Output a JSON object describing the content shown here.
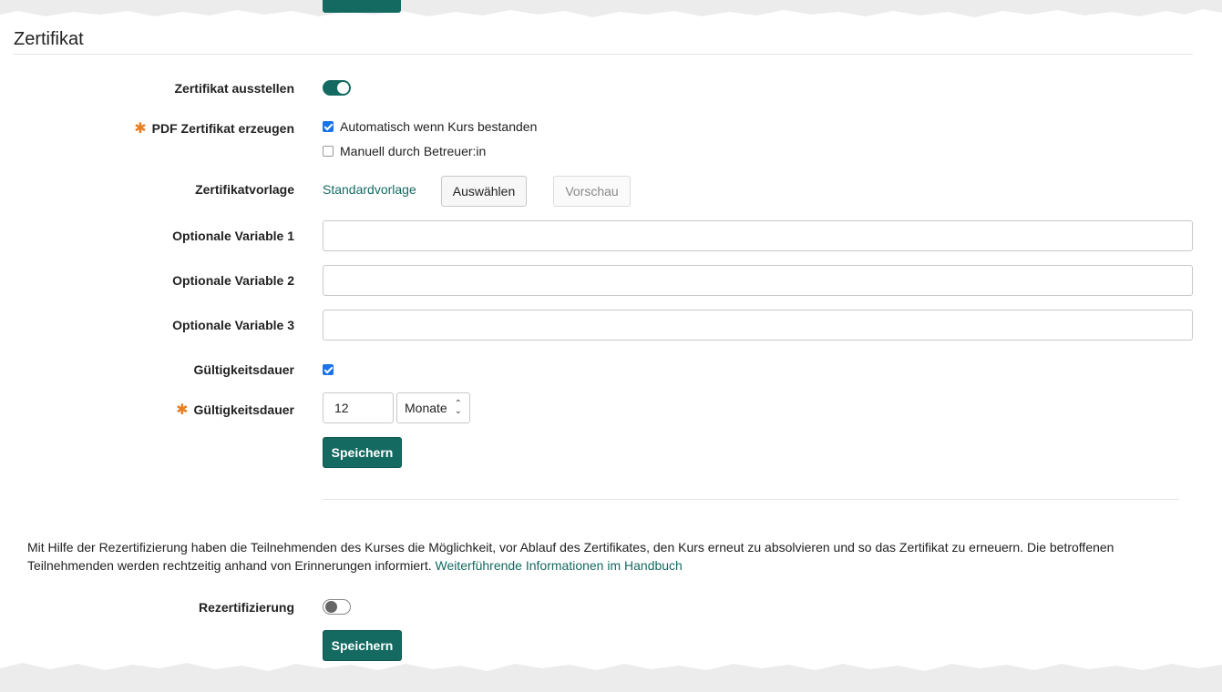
{
  "section": {
    "title": "Zertifikat"
  },
  "certificate": {
    "issue_label": "Zertifikat ausstellen",
    "issue_enabled": true,
    "pdf_label": "PDF Zertifikat erzeugen",
    "pdf_required": "✱",
    "pdf_options": [
      {
        "label": "Automatisch wenn Kurs bestanden",
        "checked": true
      },
      {
        "label": "Manuell durch Betreuer:in",
        "checked": false
      }
    ],
    "template_label": "Zertifikatvorlage",
    "template_value": "Standardvorlage",
    "select_button": "Auswählen",
    "preview_button": "Vorschau",
    "variables": [
      {
        "label": "Optionale Variable 1",
        "value": ""
      },
      {
        "label": "Optionale Variable 2",
        "value": ""
      },
      {
        "label": "Optionale Variable 3",
        "value": ""
      }
    ],
    "validity_label": "Gültigkeitsdauer",
    "validity_checked": true,
    "validity_duration_label": "Gültigkeitsdauer",
    "validity_required": "✱",
    "validity_value": "12",
    "validity_unit": "Monate",
    "save_button": "Speichern"
  },
  "recertification": {
    "info_text": "Mit Hilfe der Rezertifizierung haben die Teilnehmenden des Kurses die Möglichkeit, vor Ablauf des Zertifikates, den Kurs erneut zu absolvieren und so das Zertifikat zu erneuern. Die betroffenen Teilnehmenden werden rechtzeitig anhand von Erinnerungen informiert.",
    "info_link": "Weiterführende Informationen im Handbuch",
    "label": "Rezertifizierung",
    "enabled": false,
    "save_button": "Speichern"
  },
  "colors": {
    "accent": "#146a61",
    "required": "#e67e22",
    "checkbox": "#1a73e8"
  }
}
